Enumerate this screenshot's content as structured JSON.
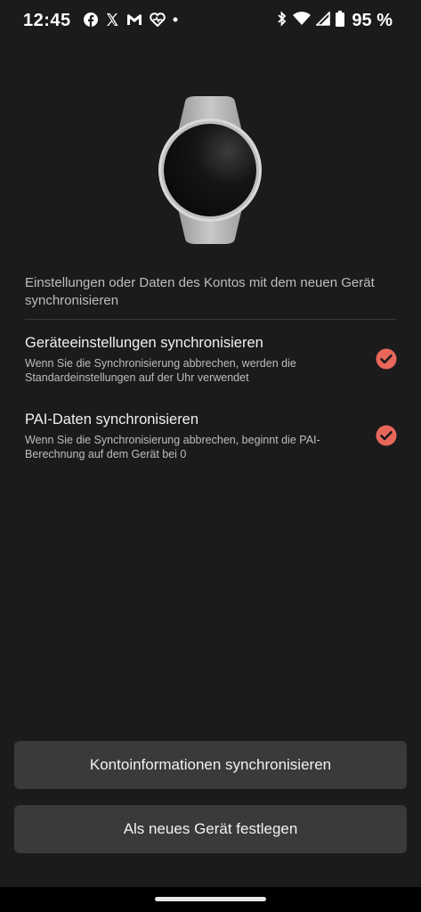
{
  "status_bar": {
    "time": "12:45",
    "notifications": [
      "facebook-icon",
      "x-icon",
      "gmail-icon",
      "health-icon",
      "dot-icon"
    ],
    "battery": "95 %"
  },
  "sync": {
    "header": "Einstellungen oder Daten des Kontos mit dem neuen Gerät synchronisieren",
    "options": [
      {
        "title": "Geräteeinstellungen synchronisieren",
        "description": "Wenn Sie die Synchronisierung abbrechen, werden die Standardeinstellungen auf der Uhr verwendet",
        "checked": true
      },
      {
        "title": "PAI-Daten synchronisieren",
        "description": "Wenn Sie die Synchronisierung abbrechen, beginnt die PAI-Berechnung auf dem Gerät bei 0",
        "checked": true
      }
    ]
  },
  "actions": {
    "primary_label": "Kontoinformationen synchronisieren",
    "secondary_label": "Als neues Gerät festlegen"
  },
  "colors": {
    "accent": "#e9675a",
    "background": "#1b1b1c",
    "button": "#3a3a3c"
  }
}
